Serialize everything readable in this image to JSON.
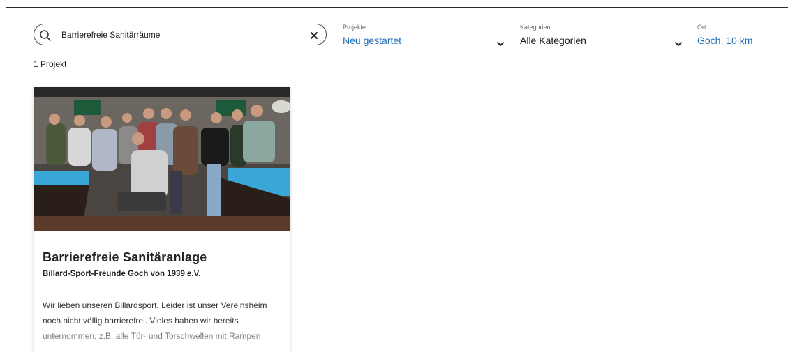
{
  "search": {
    "value": "Barrierefreie Sanitärräume",
    "icon": "search-icon",
    "clear_icon": "close-icon"
  },
  "filters": {
    "projekte": {
      "label": "Projekte",
      "value": "Neu gestartet"
    },
    "kategorien": {
      "label": "Kategorien",
      "value": "Alle Kategorien"
    },
    "ort": {
      "label": "Ort",
      "value": "Goch, 10 km"
    }
  },
  "results": {
    "count_text": "1 Projekt"
  },
  "project": {
    "title": "Barrierefreie Sanitäranlage",
    "organization": "Billard-Sport-Freunde Goch von 1939 e.V.",
    "description": "Wir lieben unseren Billardsport. Leider ist unser Vereinsheim noch nicht völlig barrierefrei. Vieles haben wir bereits unternommen, z.B. alle Tür- und Torschwellen mit Rampen"
  },
  "colors": {
    "accent": "#1e6fb5",
    "table_cloth": "#3aa6d8"
  }
}
